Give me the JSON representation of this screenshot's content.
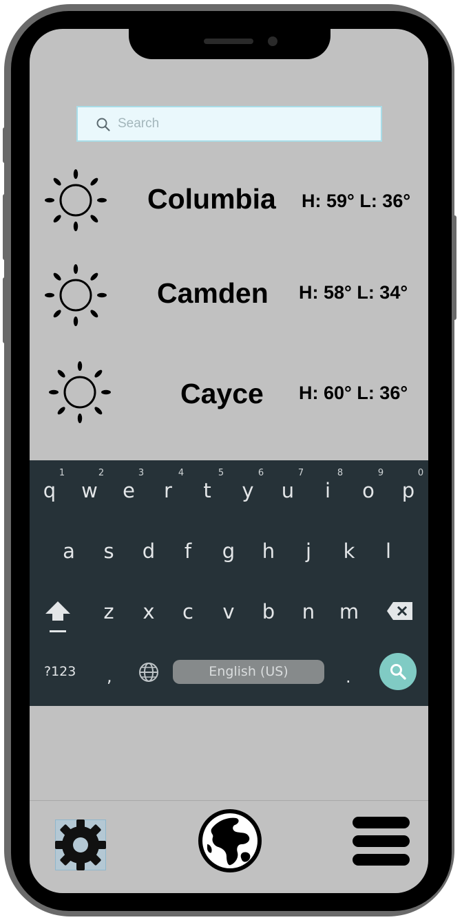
{
  "search": {
    "placeholder": "Search",
    "value": ""
  },
  "cities": [
    {
      "name": "Columbia",
      "temps": "H: 59° L: 36°",
      "icon": "sun-icon"
    },
    {
      "name": "Camden",
      "temps": "H: 58° L: 34°",
      "icon": "sun-icon"
    },
    {
      "name": "Cayce",
      "temps": "H: 60° L: 36°",
      "icon": "sun-icon"
    }
  ],
  "keyboard": {
    "row1": [
      "q",
      "w",
      "e",
      "r",
      "t",
      "y",
      "u",
      "i",
      "o",
      "p"
    ],
    "row1_hints": [
      "1",
      "2",
      "3",
      "4",
      "5",
      "6",
      "7",
      "8",
      "9",
      "0"
    ],
    "row2": [
      "a",
      "s",
      "d",
      "f",
      "g",
      "h",
      "j",
      "k",
      "l"
    ],
    "row3": [
      "z",
      "x",
      "c",
      "v",
      "b",
      "n",
      "m"
    ],
    "symbols_label": "?123",
    "comma_label": ",",
    "period_label": ".",
    "space_label": "English (US)",
    "colors": {
      "background": "#263238",
      "search_key": "#80cbc4"
    }
  },
  "nav": {
    "items": [
      {
        "icon": "gear-icon",
        "active": true
      },
      {
        "icon": "globe-icon",
        "active": false
      },
      {
        "icon": "menu-icon",
        "active": false
      }
    ]
  }
}
